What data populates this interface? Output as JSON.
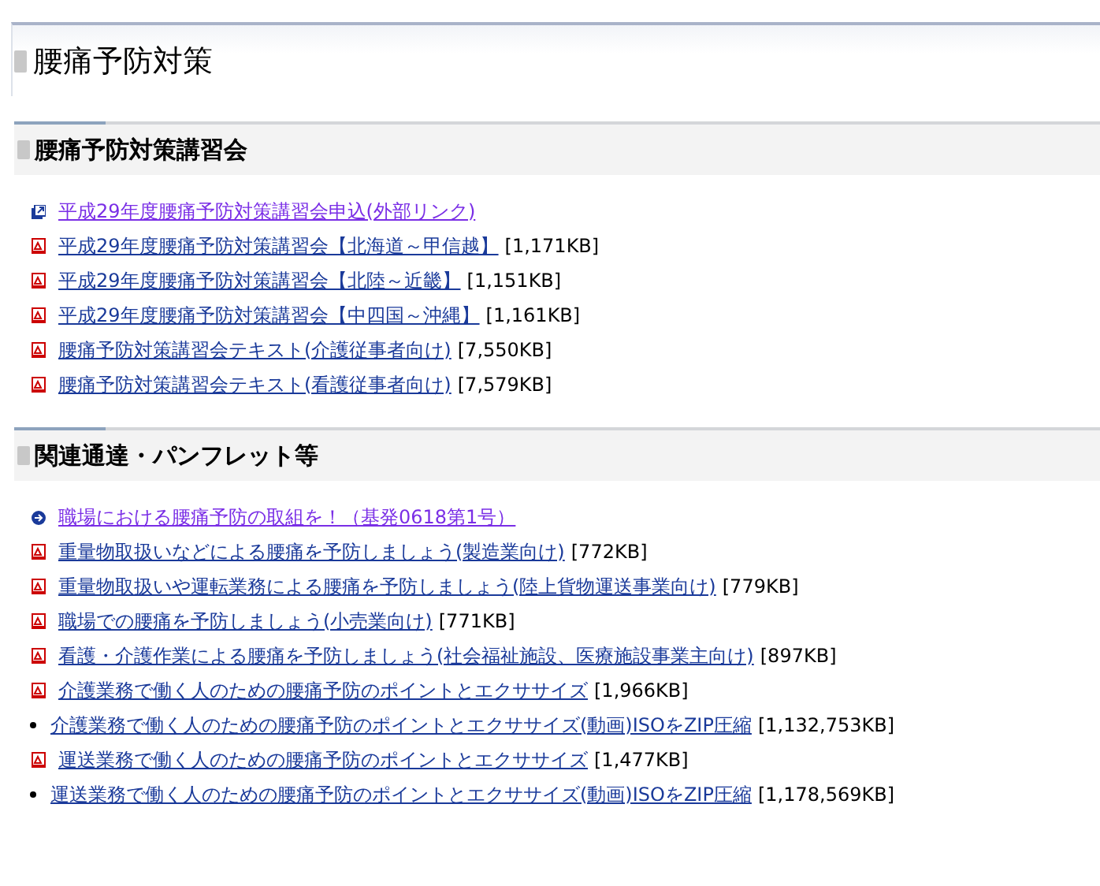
{
  "page_title": "腰痛予防対策",
  "sections": [
    {
      "heading": "腰痛予防対策講習会",
      "items": [
        {
          "kind": "external",
          "link": "平成29年度腰痛予防対策講習会申込(外部リンク)",
          "visited": true
        },
        {
          "kind": "pdf",
          "link": "平成29年度腰痛予防対策講習会【北海道～甲信越】",
          "size": "[1,171KB]",
          "visited": false
        },
        {
          "kind": "pdf",
          "link": "平成29年度腰痛予防対策講習会【北陸～近畿】",
          "size": "[1,151KB]",
          "visited": false
        },
        {
          "kind": "pdf",
          "link": "平成29年度腰痛予防対策講習会【中四国～沖縄】",
          "size": "[1,161KB]",
          "visited": false
        },
        {
          "kind": "pdf",
          "link": "腰痛予防対策講習会テキスト(介護従事者向け)",
          "size": "[7,550KB]",
          "visited": false
        },
        {
          "kind": "pdf",
          "link": "腰痛予防対策講習会テキスト(看護従事者向け)",
          "size": "[7,579KB]",
          "visited": false
        }
      ]
    },
    {
      "heading": "関連通達・パンフレット等",
      "items": [
        {
          "kind": "arrow",
          "link": "職場における腰痛予防の取組を！（基発0618第1号）",
          "visited": true
        },
        {
          "kind": "pdf",
          "link": "重量物取扱いなどによる腰痛を予防しましょう(製造業向け)",
          "size": "[772KB]",
          "visited": false
        },
        {
          "kind": "pdf",
          "link": "重量物取扱いや運転業務による腰痛を予防しましょう(陸上貨物運送事業向け)",
          "size": "[779KB]",
          "visited": false
        },
        {
          "kind": "pdf",
          "link": "職場での腰痛を予防しましょう(小売業向け)",
          "size": "[771KB]",
          "visited": false
        },
        {
          "kind": "pdf",
          "link": "看護・介護作業による腰痛を予防しましょう(社会福祉施設、医療施設事業主向け)",
          "size": "[897KB]",
          "visited": false
        },
        {
          "kind": "pdf",
          "link": "介護業務で働く人のための腰痛予防のポイントとエクササイズ",
          "size": "[1,966KB]",
          "visited": false
        },
        {
          "kind": "bullet",
          "link": "介護業務で働く人のための腰痛予防のポイントとエクササイズ(動画)ISOをZIP圧縮",
          "size": "[1,132,753KB]",
          "visited": false
        },
        {
          "kind": "pdf",
          "link": "運送業務で働く人のための腰痛予防のポイントとエクササイズ",
          "size": "[1,477KB]",
          "visited": false
        },
        {
          "kind": "bullet",
          "link": "運送業務で働く人のための腰痛予防のポイントとエクササイズ(動画)ISOをZIP圧縮",
          "size": "[1,178,569KB]",
          "visited": false
        }
      ]
    }
  ]
}
